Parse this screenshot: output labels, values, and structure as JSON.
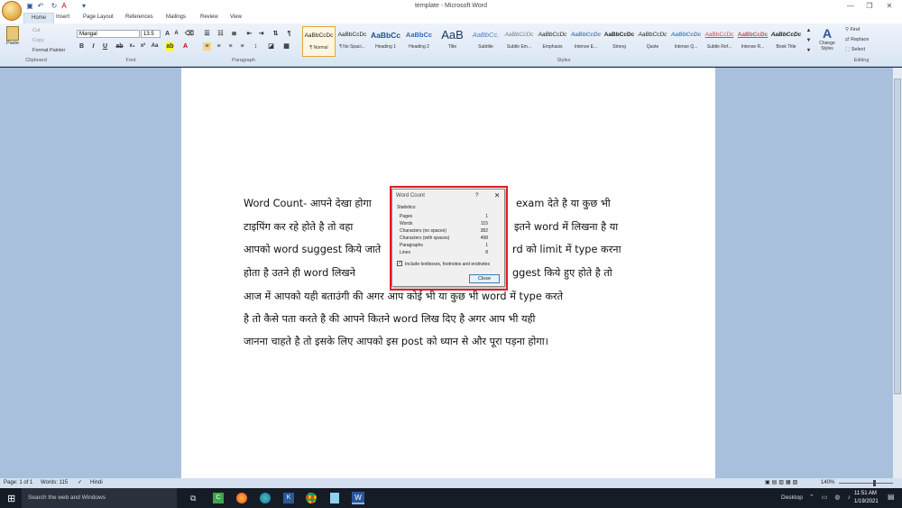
{
  "window": {
    "title": "template - Microsoft Word"
  },
  "tabs": [
    "Home",
    "Insert",
    "Page Layout",
    "References",
    "Mailings",
    "Review",
    "View"
  ],
  "clipboard": {
    "paste": "Paste",
    "cut": "Cut",
    "copy": "Copy",
    "format_painter": "Format Painter",
    "label": "Clipboard"
  },
  "font": {
    "family": "Mangal",
    "size": "13.5",
    "label": "Font"
  },
  "paragraph": {
    "label": "Paragraph"
  },
  "styles": {
    "label": "Styles",
    "items": [
      {
        "sample": "AaBbCcDc",
        "name": "¶ Normal"
      },
      {
        "sample": "AaBbCcDc",
        "name": "¶ No Spaci..."
      },
      {
        "sample": "AaBbCc",
        "name": "Heading 1"
      },
      {
        "sample": "AaBbCc",
        "name": "Heading 2"
      },
      {
        "sample": "AaB",
        "name": "Title"
      },
      {
        "sample": "AaBbCc.",
        "name": "Subtitle"
      },
      {
        "sample": "AaBbCcDc",
        "name": "Subtle Em..."
      },
      {
        "sample": "AaBbCcDc",
        "name": "Emphasis"
      },
      {
        "sample": "AaBbCcDc",
        "name": "Intense E..."
      },
      {
        "sample": "AaBbCcDc",
        "name": "Strong"
      },
      {
        "sample": "AaBbCcDc",
        "name": "Quote"
      },
      {
        "sample": "AaBbCcDc",
        "name": "Intense Q..."
      },
      {
        "sample": "AaBbCcDc",
        "name": "Subtle Ref..."
      },
      {
        "sample": "AaBbCcDc",
        "name": "Intense R..."
      },
      {
        "sample": "AaBbCcDc",
        "name": "Book Title"
      }
    ],
    "change_styles": "Change Styles"
  },
  "editing": {
    "find": "Find",
    "replace": "Replace",
    "select": "Select",
    "label": "Editing"
  },
  "document": {
    "lines": [
      "Word Count- आपने देखा होगा",
      "exam देते है या कुछ भी",
      "टाइपिंग कर रहे होते है तो वहा",
      "इतने word में लिखना है या",
      "आपको word suggest किये जाते",
      "rd को limit में type करना",
      "होता है उतने ही word लिखने",
      "ggest किये हुए होते है तो",
      "आज में आपको यही बताउंगी की अगर आप कोई भी या कुछ भी word में type करते",
      "है तो कैसे पता करते है की आपने कितने word लिख दिए है अगर आप भी यही",
      "जानना चाहते है तो इसके लिए आपको इस post को ध्यान से और पूरा पड़ना होगा।"
    ]
  },
  "dialog": {
    "title": "Word Count",
    "help": "?",
    "statistics_label": "Statistics:",
    "stats": [
      {
        "label": "Pages",
        "value": "1"
      },
      {
        "label": "Words",
        "value": "115"
      },
      {
        "label": "Characters (no spaces)",
        "value": "382"
      },
      {
        "label": "Characters (with spaces)",
        "value": "498"
      },
      {
        "label": "Paragraphs",
        "value": "1"
      },
      {
        "label": "Lines",
        "value": "8"
      }
    ],
    "checkbox_label": "Include textboxes, footnotes and endnotes",
    "close_label": "Close"
  },
  "status": {
    "page": "Page: 1 of 1",
    "words": "Words: 115",
    "language": "Hindi",
    "zoom": "140%"
  },
  "taskbar": {
    "search_placeholder": "Search the web and Windows",
    "desktop": "Desktop",
    "time": "11:51 AM",
    "date": "1/19/2021"
  },
  "colors": {
    "word_blue": "#2b579a",
    "highlight_red": "#e11b22",
    "workspace": "#a9c0dc",
    "taskbar": "#151c26"
  }
}
